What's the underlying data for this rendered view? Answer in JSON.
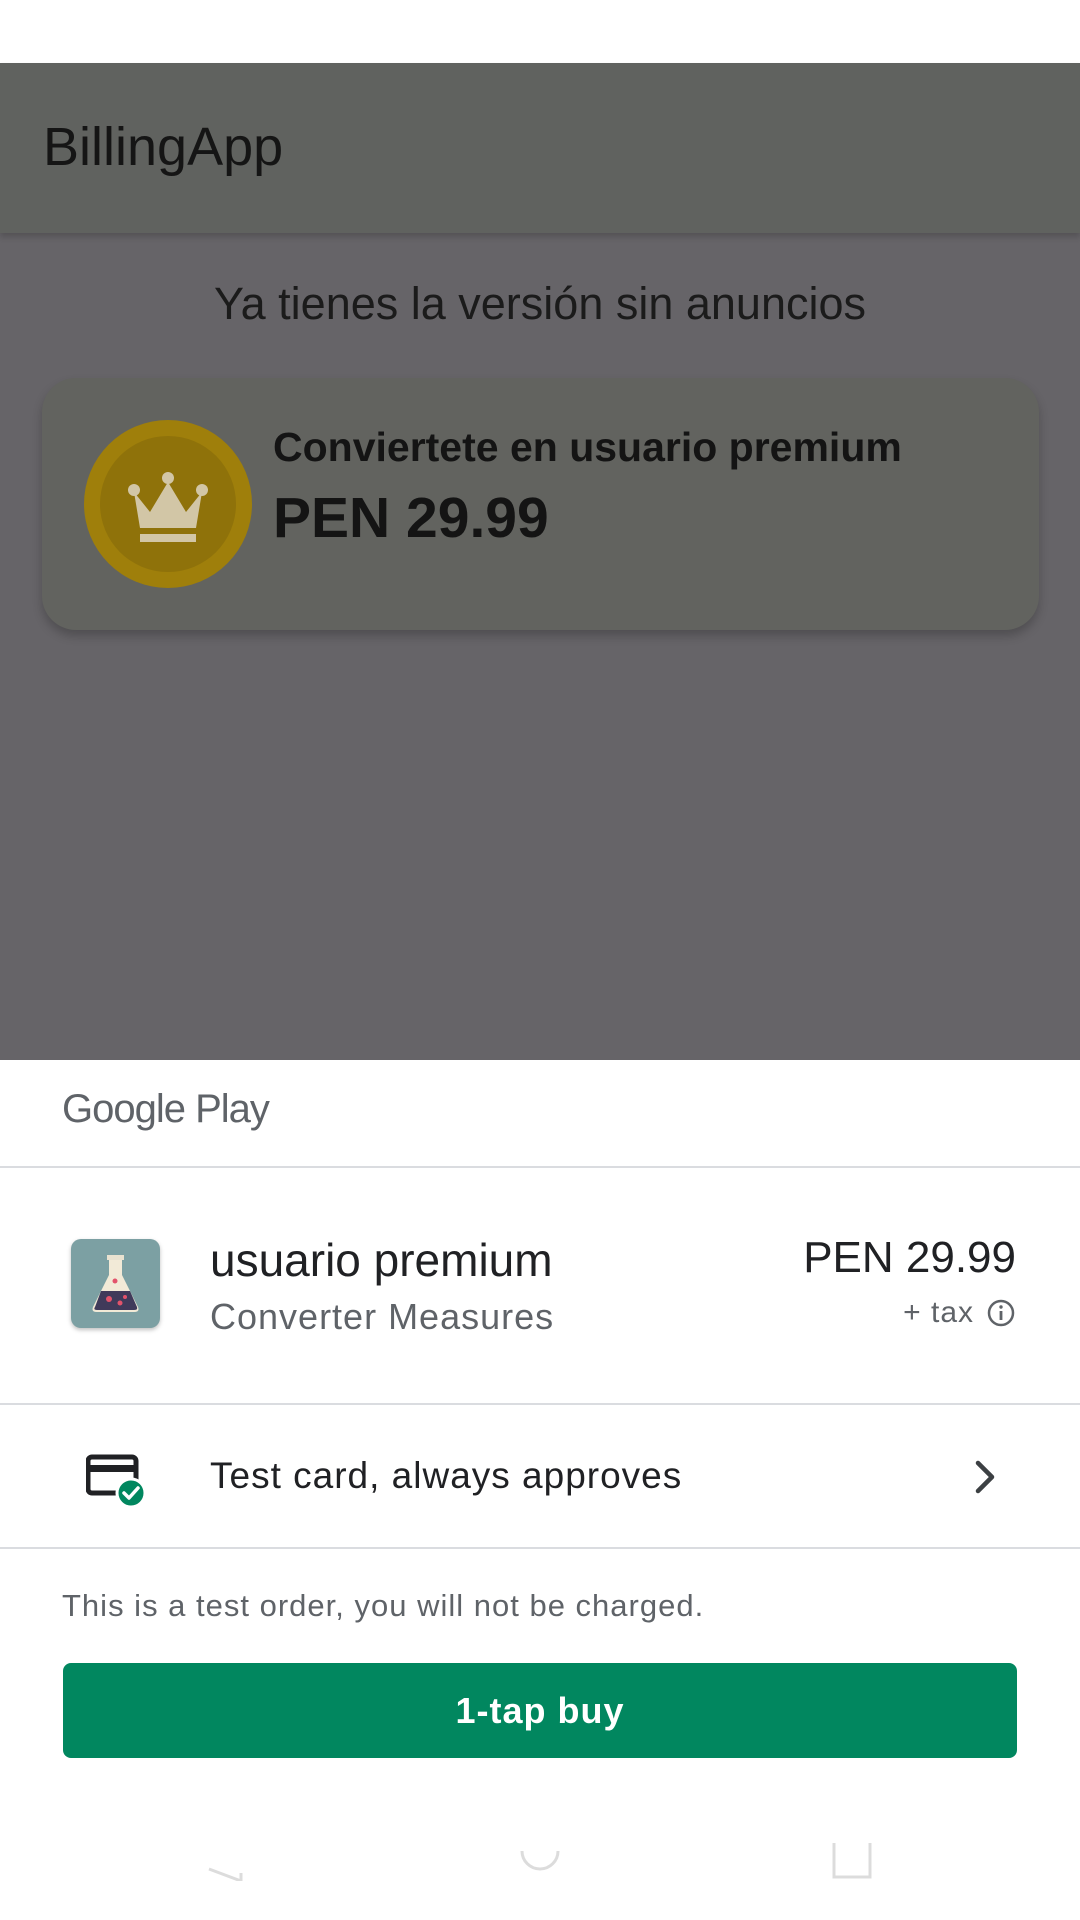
{
  "app": {
    "title": "BillingApp",
    "headline": "Ya tienes la versión sin anuncios",
    "card": {
      "title": "Conviertete en usuario premium",
      "price": "PEN 29.99",
      "icon": "crown-coin-icon"
    }
  },
  "sheet": {
    "brand": "Google Play",
    "item": {
      "name": "usuario premium",
      "app_name": "Converter Measures",
      "price": "PEN 29.99",
      "tax": "+ tax",
      "icon": "flask-icon"
    },
    "payment": {
      "label": "Test card, always approves",
      "icon": "credit-card-check-icon"
    },
    "notice": "This is a test order, you will not be charged.",
    "buy_label": "1-tap buy"
  },
  "colors": {
    "accent": "#01875f",
    "scrim": "#666468",
    "coin": "#9f7f0b"
  }
}
